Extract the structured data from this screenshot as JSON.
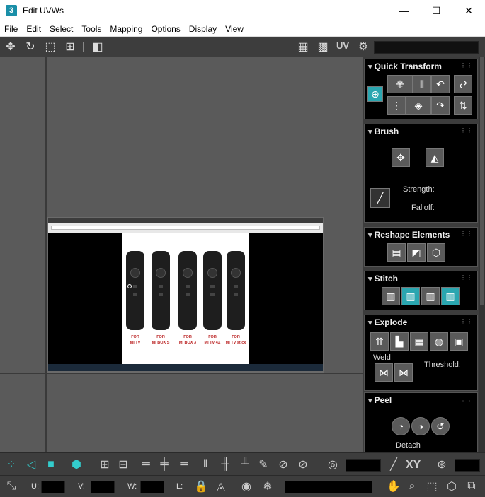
{
  "window": {
    "app_icon_text": "3",
    "title": "Edit UVWs",
    "controls": {
      "minimize": "—",
      "maximize": "☐",
      "close": "✕"
    }
  },
  "menu": [
    "File",
    "Edit",
    "Select",
    "Tools",
    "Mapping",
    "Options",
    "Display",
    "View"
  ],
  "toolbar": {
    "uv_label": "UV"
  },
  "image": {
    "remote_labels": [
      "FOR\nMI TV",
      "FOR\nMI BOX S",
      "FOR\nMI BOX 3",
      "FOR\nMI TV 4X",
      "FOR\nMI TV stick"
    ]
  },
  "panels": {
    "quick_transform": {
      "title": "Quick Transform"
    },
    "brush": {
      "title": "Brush",
      "strength_label": "Strength:",
      "falloff_label": "Falloff:"
    },
    "reshape": {
      "title": "Reshape Elements"
    },
    "stitch": {
      "title": "Stitch"
    },
    "explode": {
      "title": "Explode",
      "weld_label": "Weld",
      "threshold_label": "Threshold:"
    },
    "peel": {
      "title": "Peel",
      "detach_label": "Detach"
    }
  },
  "bottom": {
    "xy_label": "XY",
    "u_label": "U:",
    "v_label": "V:",
    "w_label": "W:",
    "l_label": "L:"
  },
  "colors": {
    "accent": "#2aa6b0",
    "panel_bg": "#000000",
    "viewport": "#5a5a5a"
  }
}
